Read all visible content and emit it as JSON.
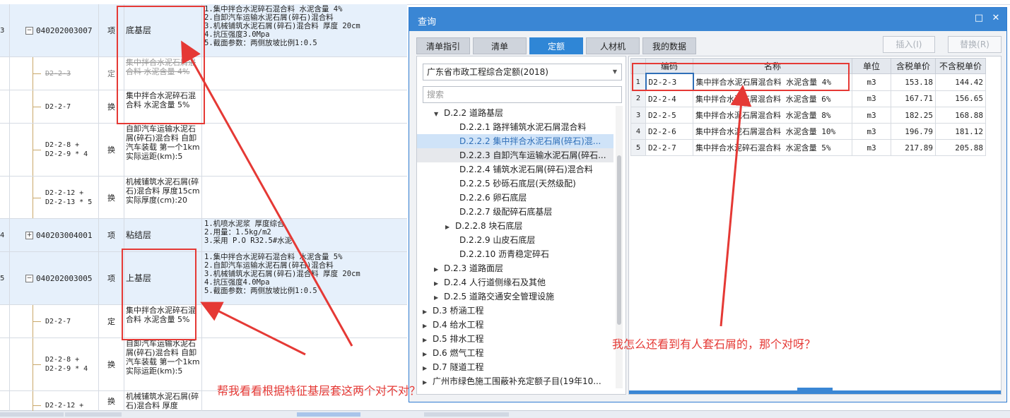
{
  "left_table": {
    "rows": [
      {
        "num": "3",
        "code": "040202003007",
        "type": "项",
        "name": "底基层",
        "features": [
          "1.集中拌合水泥碎石混合料 水泥含量 4%",
          "2.自卸汽车运输水泥石屑(碎石)混合料",
          "3.机械铺筑水泥石屑(碎石)混合料 厚度 20cm",
          "4.抗压强度3.0Mpa",
          "5.截面参数：两侧放坡比例1:0.5"
        ]
      },
      {
        "code": "D2-2-3",
        "type": "定",
        "name": "集中拌合水泥石屑混合料 水泥含量 4%"
      },
      {
        "code": "D2-2-7",
        "type": "换",
        "name": "集中拌合水泥碎石混合料 水泥含量 5%"
      },
      {
        "code": "D2-2-8 + D2-2-9 * 4",
        "type": "换",
        "name": "自卸汽车运输水泥石屑(碎石)混合料 自卸汽车装载 第一个1km 实际运距(km):5"
      },
      {
        "code": "D2-2-12 + D2-2-13 * 5",
        "type": "换",
        "name": "机械铺筑水泥石屑(碎石)混合料 厚度15cm 实际厚度(cm):20"
      },
      {
        "num": "4",
        "code": "040203004001",
        "type": "项",
        "name": "粘结层",
        "features": [
          "1.机喷水泥浆 厚度综合",
          "2.用量：1.5kg/m2",
          "3.采用 P.O R32.5#水泥"
        ]
      },
      {
        "num": "5",
        "code": "040202003005",
        "type": "项",
        "name": "上基层",
        "features": [
          "1.集中拌合水泥碎石混合料 水泥含量 5%",
          "2.自卸汽车运输水泥石屑(碎石)混合料",
          "3.机械铺筑水泥石屑(碎石)混合料 厚度 20cm",
          "4.抗压强度4.0Mpa",
          "5.截面参数：两侧放坡比例1:0.5"
        ]
      },
      {
        "code": "D2-2-7",
        "type": "定",
        "name": "集中拌合水泥碎石混合料 水泥含量 5%"
      },
      {
        "code": "D2-2-8 + D2-2-9 * 4",
        "type": "换",
        "name": "自卸汽车运输水泥石屑(碎石)混合料 自卸汽车装载 第一个1km 实际运距(km):5"
      },
      {
        "code": "D2-2-12 +",
        "type": "换",
        "name": "机械铺筑水泥石屑(碎石)混合料 厚度"
      }
    ]
  },
  "dialog": {
    "title": "查询",
    "tabs": [
      "清单指引",
      "清单",
      "定额",
      "人材机",
      "我的数据"
    ],
    "active_tab": "定额",
    "insert_label": "插入(I)",
    "replace_label": "替换(R)",
    "library": "广东省市政工程综合定额(2018)",
    "search_placeholder": "搜索",
    "tree": [
      {
        "label": "D.2.2 道路基层",
        "level": 1,
        "caret": "▼"
      },
      {
        "label": "D.2.2.1 路拌铺筑水泥石屑混合料",
        "level": 2
      },
      {
        "label": "D.2.2.2 集中拌合水泥石屑(碎石)混...",
        "level": 2,
        "state": "selected"
      },
      {
        "label": "D.2.2.3 自卸汽车运输水泥石屑(碎石...",
        "level": 2,
        "state": "hover"
      },
      {
        "label": "D.2.2.4 铺筑水泥石屑(碎石)混合料",
        "level": 2
      },
      {
        "label": "D.2.2.5 砂砾石底层(天然级配)",
        "level": 2
      },
      {
        "label": "D.2.2.6 卵石底层",
        "level": 2
      },
      {
        "label": "D.2.2.7 级配碎石底基层",
        "level": 2
      },
      {
        "label": "D.2.2.8 块石底层",
        "level": 2,
        "caret": "▶"
      },
      {
        "label": "D.2.2.9 山皮石底层",
        "level": 2
      },
      {
        "label": "D.2.2.10 沥青稳定碎石",
        "level": 2
      },
      {
        "label": "D.2.3 道路面层",
        "level": 1,
        "caret": "▶"
      },
      {
        "label": "D.2.4 人行道侧缘石及其他",
        "level": 1,
        "caret": "▶"
      },
      {
        "label": "D.2.5 道路交通安全管理设施",
        "level": 1,
        "caret": "▶"
      },
      {
        "label": "D.3 桥涵工程",
        "level": 0,
        "caret": "▶"
      },
      {
        "label": "D.4 给水工程",
        "level": 0,
        "caret": "▶"
      },
      {
        "label": "D.5 排水工程",
        "level": 0,
        "caret": "▶"
      },
      {
        "label": "D.6 燃气工程",
        "level": 0,
        "caret": "▶"
      },
      {
        "label": "D.7 隧道工程",
        "level": 0,
        "caret": "▶"
      },
      {
        "label": "广州市绿色施工围蔽补充定额子目(19年10...",
        "level": 0,
        "caret": "▶"
      }
    ],
    "table": {
      "headers": [
        "编码",
        "名称",
        "单位",
        "含税单价",
        "不含税单价"
      ],
      "rows": [
        {
          "idx": "1",
          "code": "D2-2-3",
          "name": "集中拌合水泥石屑混合料 水泥含量 4%",
          "unit": "m3",
          "price_tax": "153.18",
          "price": "144.42"
        },
        {
          "idx": "2",
          "code": "D2-2-4",
          "name": "集中拌合水泥石屑混合料 水泥含量 6%",
          "unit": "m3",
          "price_tax": "167.71",
          "price": "156.65"
        },
        {
          "idx": "3",
          "code": "D2-2-5",
          "name": "集中拌合水泥石屑混合料 水泥含量 8%",
          "unit": "m3",
          "price_tax": "182.25",
          "price": "168.88"
        },
        {
          "idx": "4",
          "code": "D2-2-6",
          "name": "集中拌合水泥石屑混合料 水泥含量 10%",
          "unit": "m3",
          "price_tax": "196.79",
          "price": "181.12"
        },
        {
          "idx": "5",
          "code": "D2-2-7",
          "name": "集中拌合水泥碎石混合料 水泥含量 5%",
          "unit": "m3",
          "price_tax": "217.89",
          "price": "205.88"
        }
      ]
    }
  },
  "annotations": {
    "note_right": "我怎么还看到有人套石屑的，那个对呀？",
    "note_bottom": "帮我看看根据特征基层套这两个对不对？",
    "color": "#e53935"
  }
}
